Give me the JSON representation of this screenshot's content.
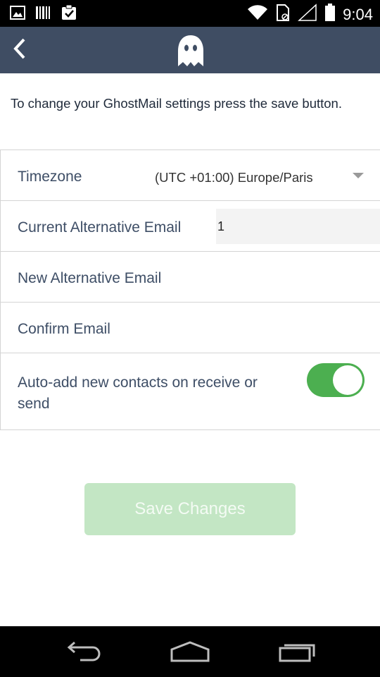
{
  "status_bar": {
    "time": "9:04",
    "left_icons": [
      "image-icon",
      "barcode-icon",
      "clipboard-check-icon"
    ],
    "right_icons": [
      "wifi-icon",
      "sim-icon",
      "signal-icon",
      "battery-icon"
    ]
  },
  "app_bar": {
    "back_icon": "chevron-left-icon",
    "logo_icon": "ghost-logo-icon",
    "background_color": "#3f4d63"
  },
  "intro_text": "To change your GhostMail settings press the save button.",
  "timezone": {
    "label": "Timezone",
    "value": "(UTC +01:00) Europe/Paris"
  },
  "current_alt_email": {
    "label": "Current Alternative Email",
    "value": "1"
  },
  "new_alt_email": {
    "label": "New Alternative Email"
  },
  "confirm_email": {
    "label": "Confirm Email"
  },
  "auto_add": {
    "label": "Auto-add new contacts on receive or send",
    "enabled": true,
    "toggle_color": "#4caf50"
  },
  "save_button": {
    "label": "Save Changes",
    "background_color": "#c3e6c4"
  },
  "nav_bar": {
    "items": [
      "back-nav-icon",
      "home-nav-icon",
      "recents-nav-icon"
    ]
  }
}
